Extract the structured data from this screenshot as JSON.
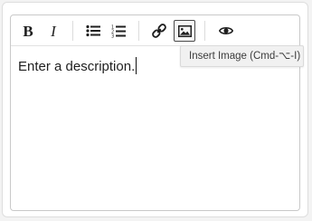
{
  "toolbar": {
    "buttons": [
      {
        "name": "bold",
        "icon": "bold-icon",
        "glyph": "B"
      },
      {
        "name": "italic",
        "icon": "italic-icon",
        "glyph": "I"
      },
      {
        "name": "bulleted-list",
        "icon": "bulleted-list-icon"
      },
      {
        "name": "numbered-list",
        "icon": "numbered-list-icon"
      },
      {
        "name": "link",
        "icon": "link-icon"
      },
      {
        "name": "insert-image",
        "icon": "image-icon",
        "active": true
      },
      {
        "name": "preview",
        "icon": "eye-icon"
      }
    ]
  },
  "editor": {
    "text": "Enter a description."
  },
  "tooltip": {
    "text": "Insert Image (Cmd-⌥-I)"
  },
  "colors": {
    "border": "#c9c9c9",
    "icon": "#1f1f1f",
    "tooltip_bg": "#f1f1f1"
  }
}
